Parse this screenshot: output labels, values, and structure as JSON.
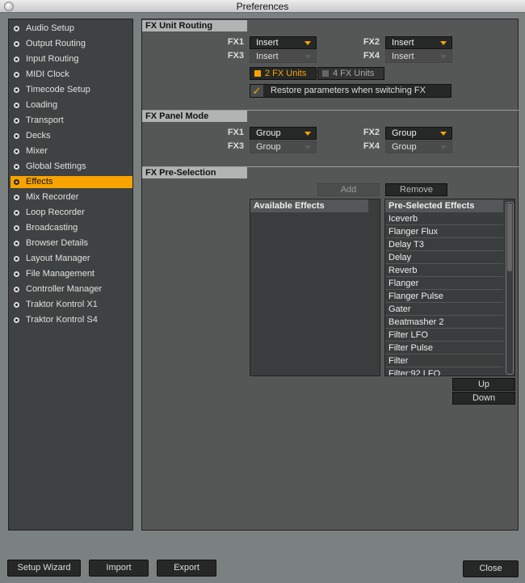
{
  "window": {
    "title": "Preferences"
  },
  "sidebar": {
    "items": [
      {
        "label": "Audio Setup"
      },
      {
        "label": "Output Routing"
      },
      {
        "label": "Input Routing"
      },
      {
        "label": "MIDI Clock"
      },
      {
        "label": "Timecode Setup"
      },
      {
        "label": "Loading"
      },
      {
        "label": "Transport"
      },
      {
        "label": "Decks"
      },
      {
        "label": "Mixer"
      },
      {
        "label": "Global Settings"
      },
      {
        "label": "Effects",
        "active": true
      },
      {
        "label": "Mix Recorder"
      },
      {
        "label": "Loop Recorder"
      },
      {
        "label": "Broadcasting"
      },
      {
        "label": "Browser Details"
      },
      {
        "label": "Layout Manager"
      },
      {
        "label": "File Management"
      },
      {
        "label": "Controller Manager"
      },
      {
        "label": "Traktor Kontrol X1"
      },
      {
        "label": "Traktor Kontrol S4"
      }
    ]
  },
  "routing": {
    "title": "FX Unit Routing",
    "fx1": {
      "label": "FX1",
      "value": "Insert"
    },
    "fx2": {
      "label": "FX2",
      "value": "Insert"
    },
    "fx3": {
      "label": "FX3",
      "value": "Insert"
    },
    "fx4": {
      "label": "FX4",
      "value": "Insert"
    },
    "units2": "2 FX Units",
    "units4": "4 FX Units",
    "selected_units": "2 FX Units",
    "restore": {
      "label": "Restore parameters when switching FX",
      "checked": true
    }
  },
  "panel_mode": {
    "title": "FX Panel Mode",
    "fx1": {
      "label": "FX1",
      "value": "Group"
    },
    "fx2": {
      "label": "FX2",
      "value": "Group"
    },
    "fx3": {
      "label": "FX3",
      "value": "Group"
    },
    "fx4": {
      "label": "FX4",
      "value": "Group"
    }
  },
  "preselection": {
    "title": "FX Pre-Selection",
    "add": "Add",
    "remove": "Remove",
    "available_header": "Available Effects",
    "preselected_header": "Pre-Selected Effects",
    "preselected": [
      "Iceverb",
      "Flanger Flux",
      "Delay T3",
      "Delay",
      "Reverb",
      "Flanger",
      "Flanger Pulse",
      "Gater",
      "Beatmasher 2",
      "Filter LFO",
      "Filter Pulse",
      "Filter",
      "Filter:92 LFO"
    ],
    "up": "Up",
    "down": "Down"
  },
  "footer": {
    "setup_wizard": "Setup Wizard",
    "import": "Import",
    "export": "Export",
    "close": "Close"
  },
  "colors": {
    "accent": "#f8a400"
  }
}
